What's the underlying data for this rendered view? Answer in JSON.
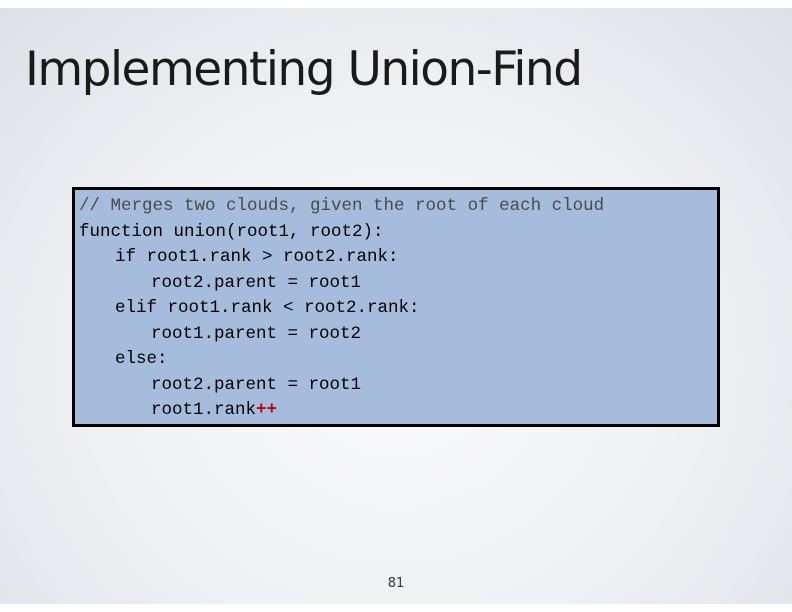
{
  "slide": {
    "title": "Implementing Union-Find",
    "page_number": "81"
  },
  "code": {
    "comment": "// Merges two clouds, given the root of each cloud",
    "lines": [
      "function union(root1, root2):",
      "if root1.rank > root2.rank:",
      "root2.parent = root1",
      "elif root1.rank < root2.rank:",
      "root1.parent = root2",
      "else:",
      "root2.parent = root1",
      "root1.rank"
    ],
    "increment_operator": "++"
  },
  "colors": {
    "code_background": "#a6bcdc",
    "increment_operator": "#c0000a"
  }
}
